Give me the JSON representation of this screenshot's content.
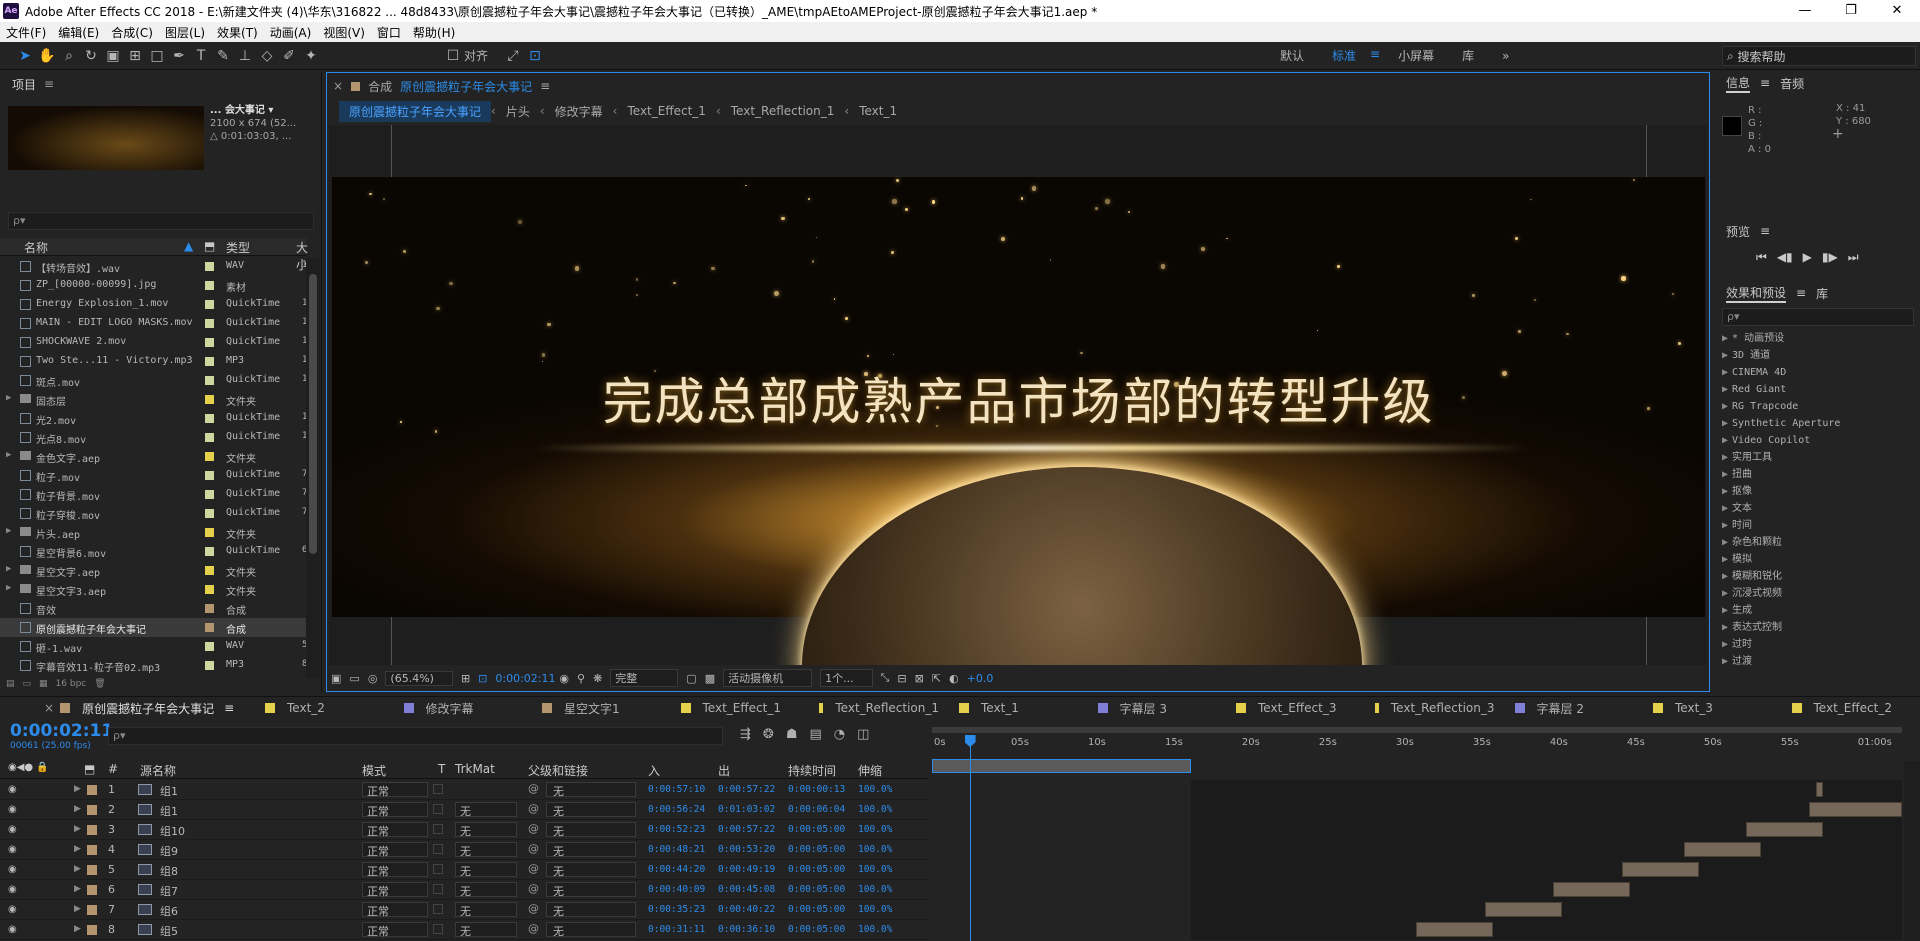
{
  "window": {
    "app_badge": "Ae",
    "title": "Adobe After Effects CC 2018 - E:\\新建文件夹 (4)\\华东\\316822 ... 48d8433\\原创震撼粒子年会大事记\\震撼粒子年会大事记（已转换）_AME\\tmpAEtoAMEProject-原创震撼粒子年会大事记1.aep *",
    "minimize": "—",
    "maximize": "❐",
    "close": "✕"
  },
  "menu": [
    "文件(F)",
    "编辑(E)",
    "合成(C)",
    "图层(L)",
    "效果(T)",
    "动画(A)",
    "视图(V)",
    "窗口",
    "帮助(H)"
  ],
  "toolbar": {
    "align_label": "对齐",
    "workspaces": [
      "默认",
      "标准",
      "小屏幕",
      "库"
    ],
    "active_workspace": "标准",
    "search_help": "搜索帮助"
  },
  "project": {
    "title": "项目",
    "thumb_name": "... 会大事记 ▾",
    "thumb_size": "2100 x 674 (52...",
    "thumb_dur": "△ 0:01:03:03, ...",
    "search_placeholder": "ρ▾",
    "col_name": "名称",
    "col_type": "类型",
    "col_size": "大小",
    "bpc": "16 bpc",
    "items": [
      {
        "name": "【转场音效】.wav",
        "type": "WAV",
        "size": "1",
        "label": "#cfd6a0",
        "folder": false
      },
      {
        "name": "ZP_[00000-00099].jpg",
        "type": "素材",
        "size": "",
        "label": "#cfd6a0",
        "folder": false
      },
      {
        "name": "Energy Explosion_1.mov",
        "type": "QuickTime",
        "size": "1",
        "label": "#cfd6a0",
        "folder": false
      },
      {
        "name": "MAIN - EDIT LOGO MASKS.mov",
        "type": "QuickTime",
        "size": "1",
        "label": "#cfd6a0",
        "folder": false
      },
      {
        "name": "SHOCKWAVE 2.mov",
        "type": "QuickTime",
        "size": "1",
        "label": "#cfd6a0",
        "folder": false
      },
      {
        "name": "Two Ste...11 - Victory.mp3",
        "type": "MP3",
        "size": "1",
        "label": "#cfd6a0",
        "folder": false
      },
      {
        "name": "斑点.mov",
        "type": "QuickTime",
        "size": "1",
        "label": "#cfd6a0",
        "folder": false
      },
      {
        "name": "固态层",
        "type": "文件夹",
        "size": "",
        "label": "#e4d04a",
        "folder": true
      },
      {
        "name": "光2.mov",
        "type": "QuickTime",
        "size": "1",
        "label": "#cfd6a0",
        "folder": false
      },
      {
        "name": "光点8.mov",
        "type": "QuickTime",
        "size": "1",
        "label": "#cfd6a0",
        "folder": false
      },
      {
        "name": "金色文字.aep",
        "type": "文件夹",
        "size": "",
        "label": "#e4d04a",
        "folder": true
      },
      {
        "name": "粒子.mov",
        "type": "QuickTime",
        "size": "7",
        "label": "#cfd6a0",
        "folder": false
      },
      {
        "name": "粒子背景.mov",
        "type": "QuickTime",
        "size": "7",
        "label": "#cfd6a0",
        "folder": false
      },
      {
        "name": "粒子穿梭.mov",
        "type": "QuickTime",
        "size": "7",
        "label": "#cfd6a0",
        "folder": false
      },
      {
        "name": "片头.aep",
        "type": "文件夹",
        "size": "",
        "label": "#e4d04a",
        "folder": true
      },
      {
        "name": "星空背景6.mov",
        "type": "QuickTime",
        "size": "6",
        "label": "#cfd6a0",
        "folder": false
      },
      {
        "name": "星空文字.aep",
        "type": "文件夹",
        "size": "",
        "label": "#e4d04a",
        "folder": true
      },
      {
        "name": "星空文字3.aep",
        "type": "文件夹",
        "size": "",
        "label": "#e4d04a",
        "folder": true
      },
      {
        "name": "音效",
        "type": "合成",
        "size": "",
        "label": "#b39570",
        "folder": false
      },
      {
        "name": "原创震撼粒子年会大事记",
        "type": "合成",
        "size": "",
        "label": "#b39570",
        "folder": false
      },
      {
        "name": "砸-1.wav",
        "type": "WAV",
        "size": "5",
        "label": "#cfd6a0",
        "folder": false
      },
      {
        "name": "字幕音效11-粒子音02.mp3",
        "type": "MP3",
        "size": "8",
        "label": "#cfd6a0",
        "folder": false
      }
    ],
    "selected_index": 19
  },
  "composition": {
    "tab_prefix": "合成",
    "tab_name": "原创震撼粒子年会大事记",
    "breadcrumbs": [
      "原创震撼粒子年会大事记",
      "片头",
      "修改字幕",
      "Text_Effect_1",
      "Text_Reflection_1",
      "Text_1"
    ],
    "frame_text": "完成总部成熟产品市场部的转型升级",
    "zoom": "(65.4%)",
    "timecode": "0:00:02:11",
    "resolution": "完整",
    "camera": "活动摄像机",
    "views": "1个...",
    "exposure": "+0.0"
  },
  "info": {
    "tab": "信息",
    "tab2": "音频",
    "r": "R :",
    "g": "G :",
    "b": "B :",
    "a": "A : 0",
    "x": "X : 41",
    "y": "Y : 680",
    "crosshair": "+"
  },
  "preview": {
    "tab": "预览",
    "buttons": [
      "⏮",
      "◀▮",
      "▶",
      "▮▶",
      "⏭"
    ]
  },
  "effects": {
    "tab": "效果和预设",
    "tab2": "库",
    "search_placeholder": "ρ▾",
    "items": [
      "* 动画预设",
      "3D 通道",
      "CINEMA 4D",
      "Red Giant",
      "RG Trapcode",
      "Synthetic Aperture",
      "Video Copilot",
      "实用工具",
      "扭曲",
      "抠像",
      "文本",
      "时间",
      "杂色和颗粒",
      "模拟",
      "模糊和锐化",
      "沉浸式视频",
      "生成",
      "表达式控制",
      "过时",
      "过渡"
    ]
  },
  "timeline": {
    "tabs": [
      {
        "name": "原创震撼粒子年会大事记",
        "color": "#b39570",
        "active": true
      },
      {
        "name": "Text_2",
        "color": "#e4d04a"
      },
      {
        "name": "修改字幕",
        "color": "#7f7fd8"
      },
      {
        "name": "星空文字1",
        "color": "#b39570"
      },
      {
        "name": "Text_Effect_1",
        "color": "#e4d04a"
      },
      {
        "name": "Text_Reflection_1",
        "color": "#e4d04a"
      },
      {
        "name": "Text_1",
        "color": "#e4d04a"
      },
      {
        "name": "字幕层 3",
        "color": "#7f7fd8"
      },
      {
        "name": "Text_Effect_3",
        "color": "#e4d04a"
      },
      {
        "name": "Text_Reflection_3",
        "color": "#e4d04a"
      },
      {
        "name": "字幕层 2",
        "color": "#7f7fd8"
      },
      {
        "name": "Text_3",
        "color": "#e4d04a"
      },
      {
        "name": "Text_Effect_2",
        "color": "#e4d04a"
      }
    ],
    "timecode": "0:00:02:11",
    "frames": "00061 (25.00 fps)",
    "search_placeholder": "ρ▾",
    "columns": {
      "num": "#",
      "source": "源名称",
      "mode": "模式",
      "t": "T",
      "trkmat": "TrkMat",
      "parent": "父级和链接",
      "in": "入",
      "out": "出",
      "duration": "持续时间",
      "stretch": "伸缩"
    },
    "ruler": [
      "0s",
      "05s",
      "10s",
      "15s",
      "20s",
      "25s",
      "30s",
      "35s",
      "40s",
      "45s",
      "50s",
      "55s",
      "01:00s"
    ],
    "ruler_max_seconds": 63,
    "cti_seconds": 2.44,
    "work_area_end_seconds": 16.8,
    "layers": [
      {
        "num": "1",
        "name": "组1",
        "mode": "正常",
        "trkmat": "",
        "parent": "无",
        "in": "0:00:57:10",
        "out": "0:00:57:22",
        "dur": "0:00:00:13",
        "str": "100.0%",
        "start": 57.4,
        "end": 57.9
      },
      {
        "num": "2",
        "name": "组1",
        "mode": "正常",
        "trkmat": "无",
        "parent": "无",
        "in": "0:00:56:24",
        "out": "0:01:03:02",
        "dur": "0:00:06:04",
        "str": "100.0%",
        "start": 56.96,
        "end": 63.1
      },
      {
        "num": "3",
        "name": "组10",
        "mode": "正常",
        "trkmat": "无",
        "parent": "无",
        "in": "0:00:52:23",
        "out": "0:00:57:22",
        "dur": "0:00:05:00",
        "str": "100.0%",
        "start": 52.9,
        "end": 57.9
      },
      {
        "num": "4",
        "name": "组9",
        "mode": "正常",
        "trkmat": "无",
        "parent": "无",
        "in": "0:00:48:21",
        "out": "0:00:53:20",
        "dur": "0:00:05:00",
        "str": "100.0%",
        "start": 48.84,
        "end": 53.84
      },
      {
        "num": "5",
        "name": "组8",
        "mode": "正常",
        "trkmat": "无",
        "parent": "无",
        "in": "0:00:44:20",
        "out": "0:00:49:19",
        "dur": "0:00:05:00",
        "str": "100.0%",
        "start": 44.8,
        "end": 49.8
      },
      {
        "num": "6",
        "name": "组7",
        "mode": "正常",
        "trkmat": "无",
        "parent": "无",
        "in": "0:00:40:09",
        "out": "0:00:45:08",
        "dur": "0:00:05:00",
        "str": "100.0%",
        "start": 40.36,
        "end": 45.36
      },
      {
        "num": "7",
        "name": "组6",
        "mode": "正常",
        "trkmat": "无",
        "parent": "无",
        "in": "0:00:35:23",
        "out": "0:00:40:22",
        "dur": "0:00:05:00",
        "str": "100.0%",
        "start": 35.92,
        "end": 40.92
      },
      {
        "num": "8",
        "name": "组5",
        "mode": "正常",
        "trkmat": "无",
        "parent": "无",
        "in": "0:00:31:11",
        "out": "0:00:36:10",
        "dur": "0:00:05:00",
        "str": "100.0%",
        "start": 31.44,
        "end": 36.44
      }
    ]
  }
}
